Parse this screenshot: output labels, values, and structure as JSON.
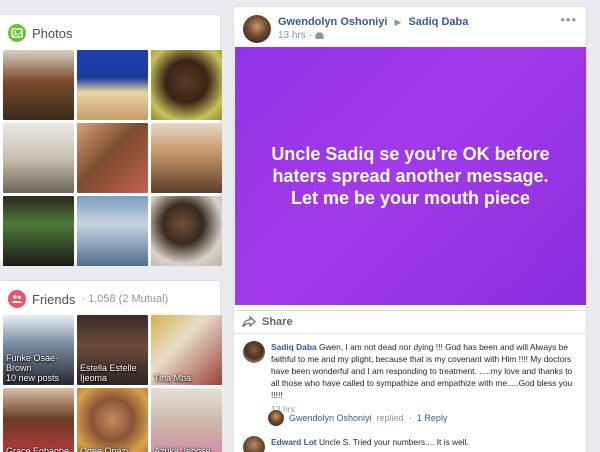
{
  "photos": {
    "title": "Photos",
    "tiles": [
      {
        "name": "photo-1",
        "bg": "linear-gradient(180deg,#d7d0c5 0%,#7a4a2a 45%,#3b2a1c 100%)"
      },
      {
        "name": "photo-2",
        "bg": "linear-gradient(180deg,#1f3fae 0%,#1c3b9c 40%,#e7d7a4 60%,#c79b6b 100%)"
      },
      {
        "name": "photo-3",
        "bg": "radial-gradient(circle at 50% 45%,#5a3a25 0%,#3a2416 40%,#c6c25c 75%,#8f8c2e 100%)"
      },
      {
        "name": "photo-4",
        "bg": "linear-gradient(180deg,#ece8e2 0%,#c9bfb2 50%,#6d6456 100%)"
      },
      {
        "name": "photo-5",
        "bg": "linear-gradient(135deg,#d9a07a 0%,#7a4c2f 45%,#c6604f 100%)"
      },
      {
        "name": "photo-6",
        "bg": "linear-gradient(180deg,#e5d9c8 0%,#c99a6a 40%,#5a3f2c 100%)"
      },
      {
        "name": "photo-7",
        "bg": "linear-gradient(180deg,#2f2820 0%,#4e7a3a 40%,#1c1a16 100%)"
      },
      {
        "name": "photo-8",
        "bg": "linear-gradient(180deg,#7d9cc4 0%,#c7d4e0 40%,#516e8e 100%)"
      },
      {
        "name": "photo-9",
        "bg": "radial-gradient(circle at 45% 40%,#6e5038 0%,#3a2b1f 35%,#d7d3ca 70%,#b9b4aa 100%)"
      }
    ]
  },
  "friends": {
    "title": "Friends",
    "count": "· 1,058 (2 Mutual)",
    "tiles": [
      {
        "label": "Funke Osae-Brown\n10 new posts",
        "bg": "linear-gradient(180deg,#e9eef5 0%,#7d8fa6 40%,#2a2830 100%)"
      },
      {
        "label": "Estella Estelle Ijeoma",
        "bg": "linear-gradient(180deg,#3a2c2a 0%,#6e4a3a 45%,#2e2522 100%)"
      },
      {
        "label": "Tina Mba",
        "bg": "linear-gradient(135deg,#d9b24a 0%,#e7ddc8 40%,#9a3f3a 100%)"
      },
      {
        "label": "Grace Egbagbe",
        "bg": "linear-gradient(180deg,#d8c0a6 0%,#6a3a26 45%,#c13a3a 100%)"
      },
      {
        "label": "Ogee Onazi",
        "bg": "radial-gradient(circle at 50% 45%,#c48a5e 0%,#8a5536 40%,#d8a24a 75%,#a86b2a 100%)"
      },
      {
        "label": "Azuka Jebose",
        "bg": "linear-gradient(180deg,#e7e0d6 0%,#c9b7a8 50%,#d48aa8 100%)"
      }
    ]
  },
  "post": {
    "author": "Gwendolyn Oshoniyi",
    "target": "Sadiq Daba",
    "time": "13 hrs",
    "status_text": "Uncle Sadiq se you're OK before haters spread another message. Let me be your mouth piece",
    "share_label": "Share"
  },
  "comments": [
    {
      "author": "Sadiq Daba",
      "text": "Gwen, I am not dead nor dying !!! God has been and will Always be faithful to me and my plight, because that is my covenant with Him !!!! My doctors have been wonderful and I am responding to treatment. .....my love and thanks to all those who have called to sympathize and empathize with me.....God bless you !!!!!",
      "time": "13 hrs"
    },
    {
      "author": "Edward Lot",
      "text": "Uncle S. Tried your numbers.... It is well."
    }
  ],
  "reply": {
    "author": "Gwendolyn Oshoniyi",
    "action": "replied",
    "count": "1 Reply"
  },
  "colors": {
    "link": "#365899",
    "status_bg": "#9233e8",
    "photos_icon": "#6bbf3a",
    "friends_icon": "#e9546b"
  }
}
